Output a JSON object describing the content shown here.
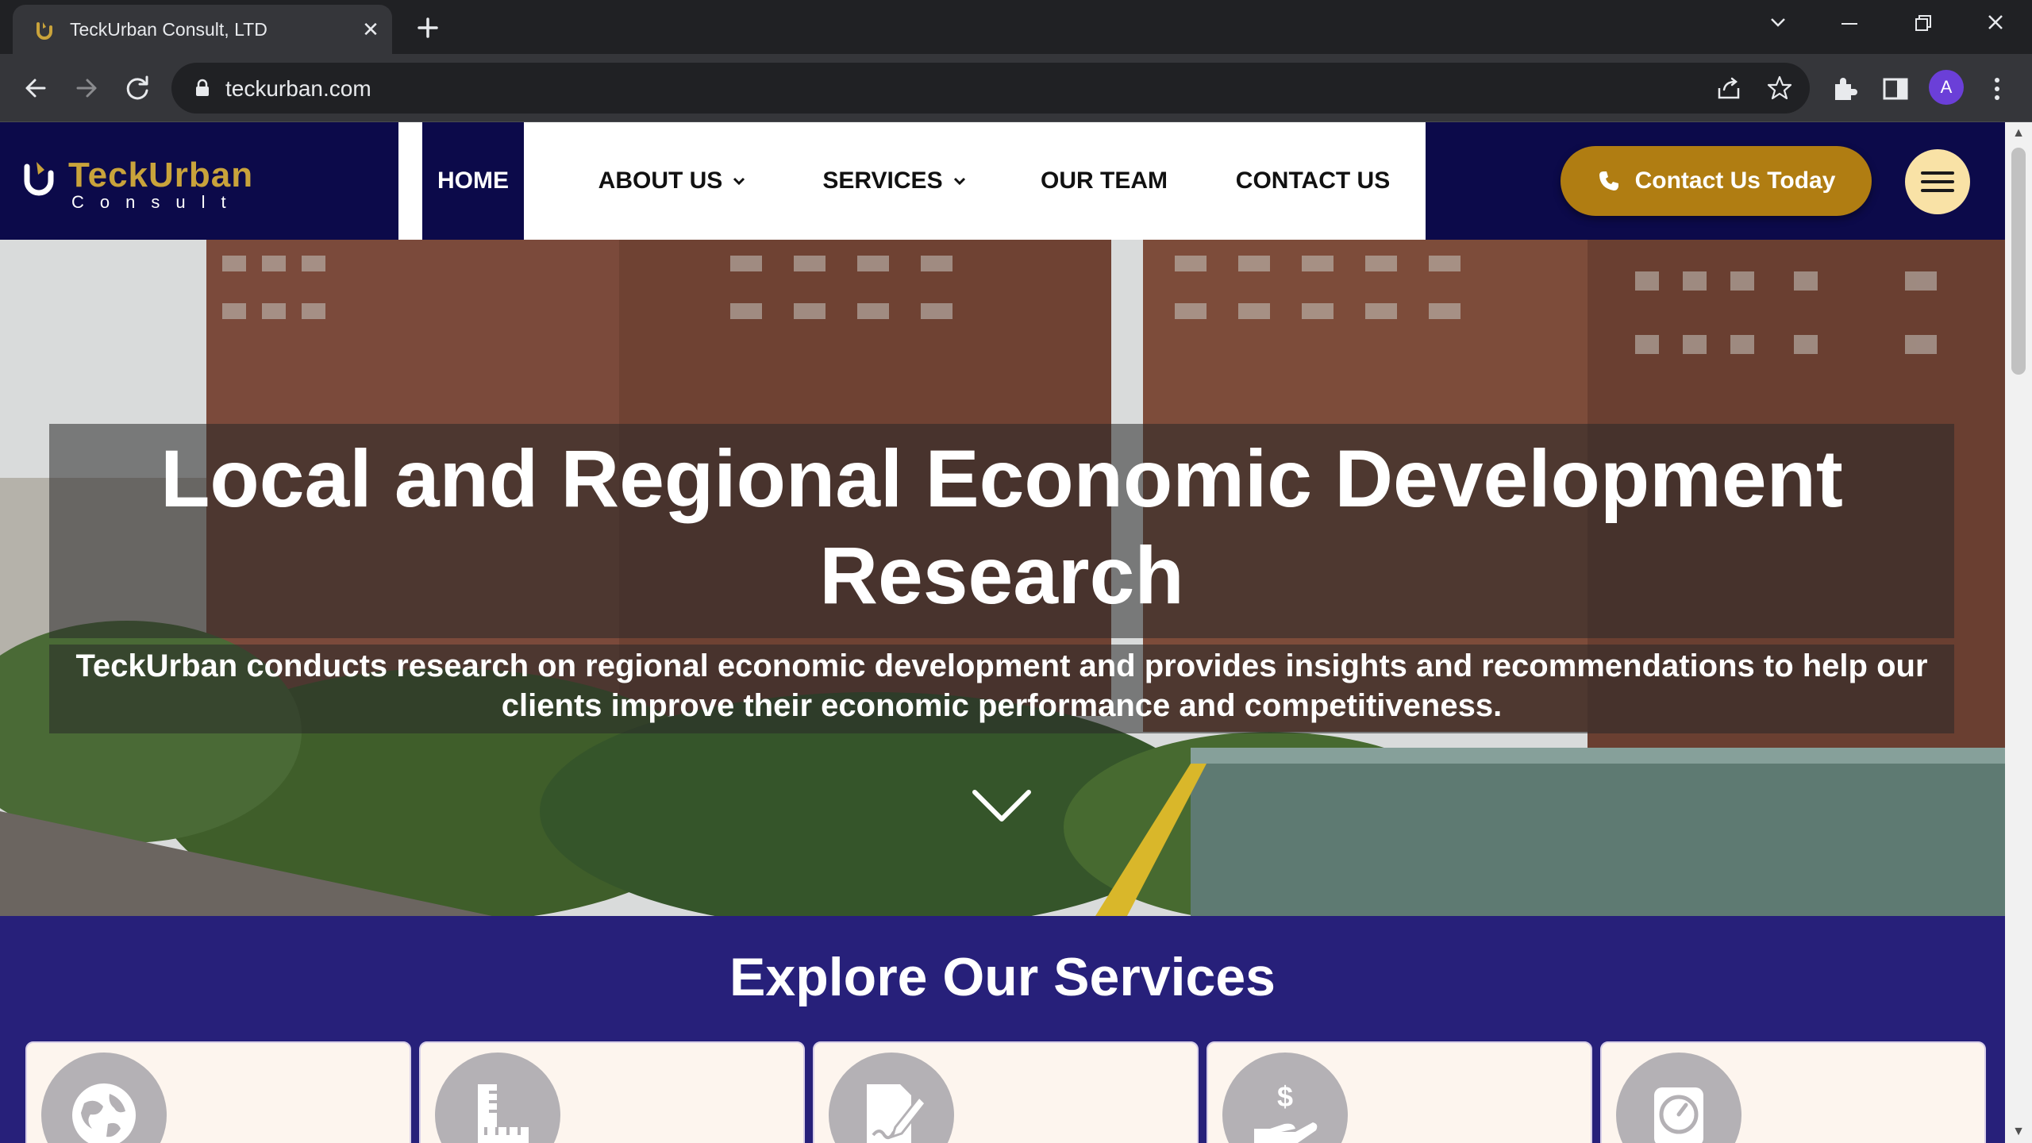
{
  "browser": {
    "tab_title": "TeckUrban Consult, LTD",
    "url": "teckurban.com",
    "profile_initial": "A"
  },
  "site": {
    "logo_word": "TeckUrban",
    "logo_sub": "Consult",
    "nav": [
      {
        "label": "HOME",
        "active": true
      },
      {
        "label": "ABOUT US",
        "dropdown": true
      },
      {
        "label": "SERVICES",
        "dropdown": true
      },
      {
        "label": "OUR TEAM"
      },
      {
        "label": "CONTACT US"
      }
    ],
    "cta_label": "Contact Us Today"
  },
  "hero": {
    "title": "Local and Regional Economic Development Research",
    "subtitle": "TeckUrban conducts research on regional economic development and provides insights and recommendations to help our clients improve their economic performance and competitiveness."
  },
  "services": {
    "title": "Explore Our Services",
    "cards": [
      {
        "icon": "globe-icon"
      },
      {
        "icon": "ruler-icon"
      },
      {
        "icon": "document-edit-icon"
      },
      {
        "icon": "money-hand-icon"
      },
      {
        "icon": "clock-icon"
      }
    ]
  },
  "colors": {
    "header_bg": "#0c0a4a",
    "brand_gold": "#c9a33b",
    "cta_bg": "#b07d12",
    "services_bg": "#27207a"
  }
}
